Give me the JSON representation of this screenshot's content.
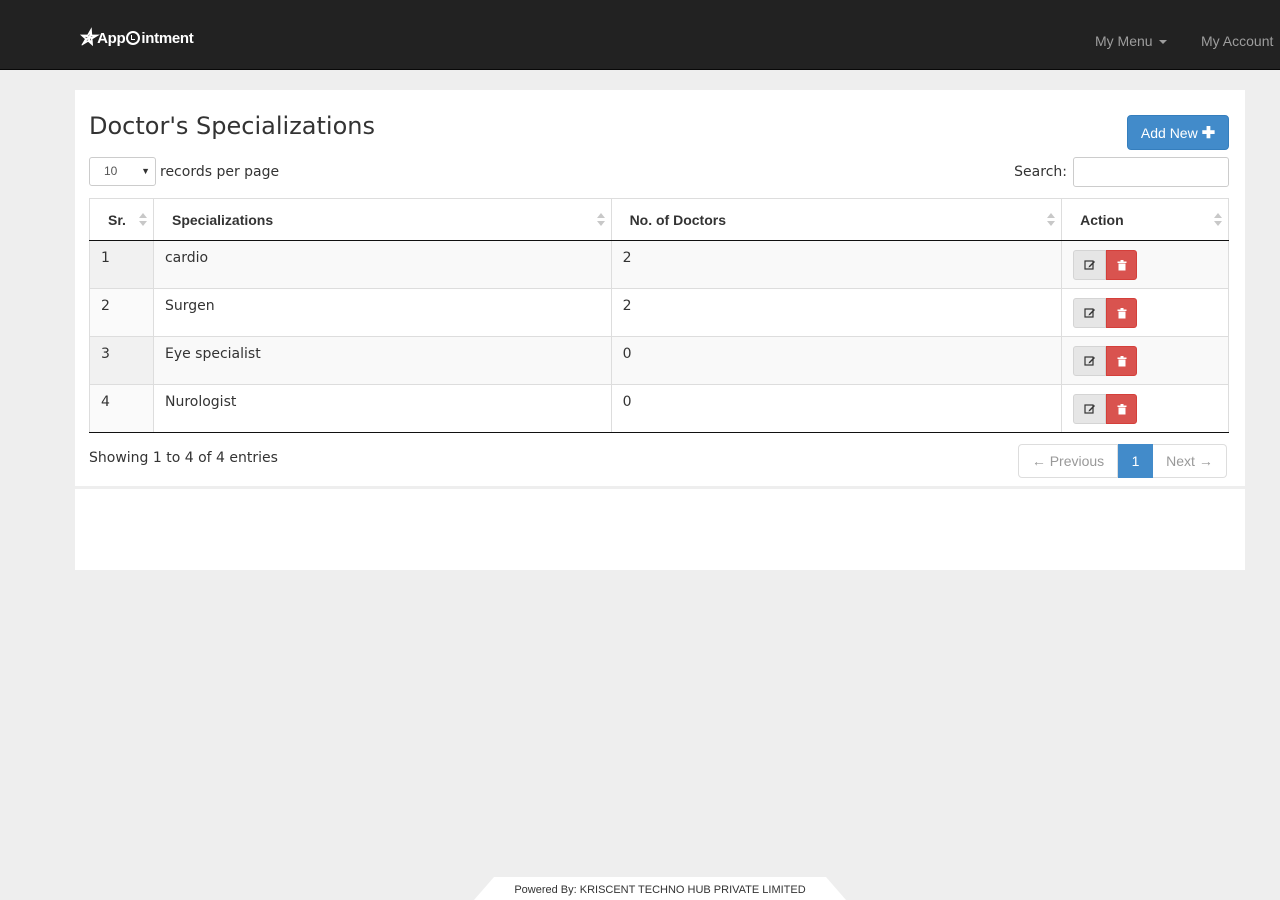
{
  "navbar": {
    "brand_star": "✯",
    "brand_text_a": "App",
    "brand_text_b": "intment",
    "menu_label": "My Menu",
    "account_label": "My Account"
  },
  "page": {
    "title": "Doctor's Specializations",
    "add_button_label": "Add New",
    "add_button_icon": "plus-icon"
  },
  "controls": {
    "page_length_value": "10",
    "page_length_label": "records per page",
    "search_label": "Search:",
    "search_value": ""
  },
  "table": {
    "columns": [
      "Sr.",
      "Specializations",
      "No. of Doctors",
      "Action"
    ],
    "rows": [
      {
        "sr": "1",
        "specialization": "cardio",
        "doctors": "2"
      },
      {
        "sr": "2",
        "specialization": "Surgen",
        "doctors": "2"
      },
      {
        "sr": "3",
        "specialization": "Eye specialist",
        "doctors": "0"
      },
      {
        "sr": "4",
        "specialization": "Nurologist",
        "doctors": "0"
      }
    ],
    "row_actions": [
      "edit-icon",
      "trash-icon"
    ]
  },
  "pagination": {
    "info": "Showing 1 to 4 of 4 entries",
    "prev_label": "← Previous",
    "current_page": "1",
    "next_label": "Next →"
  },
  "footer": {
    "text": "Powered By: KRISCENT TECHNO HUB PRIVATE LIMITED"
  },
  "colors": {
    "navbar": "#222222",
    "primary": "#428bca",
    "danger": "#d9534f",
    "background": "#eeeeee"
  }
}
